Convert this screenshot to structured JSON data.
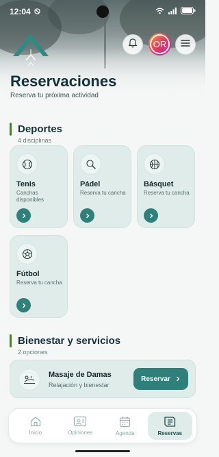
{
  "status": {
    "time": "12:04"
  },
  "header": {
    "title": "Reservaciones",
    "subtitle": "Reserva tu próxima actividad",
    "avatar_initials": "OR"
  },
  "sports": {
    "title": "Deportes",
    "count": "4 disciplinas",
    "items": [
      {
        "title": "Tenis",
        "description": "Canchas disponibles",
        "icon": "tennis-ball-icon"
      },
      {
        "title": "Pádel",
        "description": "Reserva tu cancha",
        "icon": "padel-racket-icon"
      },
      {
        "title": "Básquet",
        "description": "Reserva tu cancha",
        "icon": "basketball-icon"
      },
      {
        "title": "Fútbol",
        "description": "Reserva tu cancha",
        "icon": "soccer-ball-icon"
      }
    ]
  },
  "wellness": {
    "title": "Bienestar y servicios",
    "count": "2 opciones",
    "items": [
      {
        "title": "Masaje de Damas",
        "description": "Relajación y bienestar",
        "button": "Reservar",
        "icon": "massage-icon"
      }
    ]
  },
  "tabs": [
    {
      "label": "Inicio",
      "icon": "home-icon",
      "active": false
    },
    {
      "label": "Opiniones",
      "icon": "reviews-icon",
      "active": false
    },
    {
      "label": "Agenda",
      "icon": "calendar-icon",
      "active": false
    },
    {
      "label": "Reservas",
      "icon": "reservations-icon",
      "active": true
    }
  ],
  "colors": {
    "accent": "#2f7f7a",
    "section_bar": "#4c7b34",
    "card_bg": "#dfece9"
  }
}
